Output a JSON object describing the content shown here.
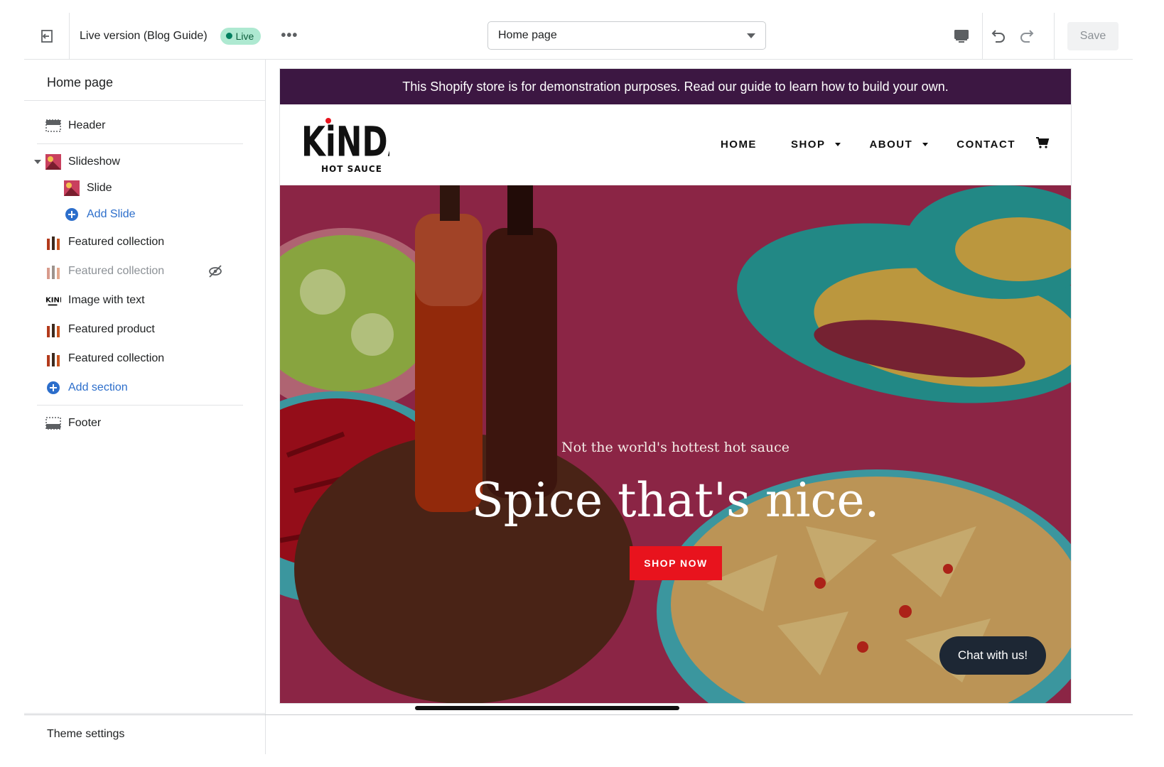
{
  "topbar": {
    "version_label": "Live version (Blog Guide)",
    "live_badge": "Live",
    "more_label": "•••",
    "page_select_value": "Home page",
    "save_label": "Save"
  },
  "sidebar": {
    "title": "Home page",
    "items": [
      {
        "label": "Header"
      },
      {
        "label": "Slideshow"
      },
      {
        "label": "Slide"
      },
      {
        "label": "Add Slide"
      },
      {
        "label": "Featured collection"
      },
      {
        "label": "Featured collection"
      },
      {
        "label": "Image with text"
      },
      {
        "label": "Featured product"
      },
      {
        "label": "Featured collection"
      },
      {
        "label": "Add section"
      },
      {
        "label": "Footer"
      }
    ],
    "theme_settings": "Theme settings"
  },
  "preview": {
    "announcement": "This Shopify store is for demonstration purposes. Read our guide to learn how to build your own.",
    "logo_text": "KiNDA",
    "logo_sub": "HOT SAUCE",
    "nav": {
      "home": "HOME",
      "shop": "SHOP",
      "about": "ABOUT",
      "contact": "CONTACT"
    },
    "hero": {
      "subtitle": "Not the world's hottest hot sauce",
      "title": "Spice that's nice.",
      "cta": "SHOP NOW"
    },
    "chat_label": "Chat with us!"
  }
}
